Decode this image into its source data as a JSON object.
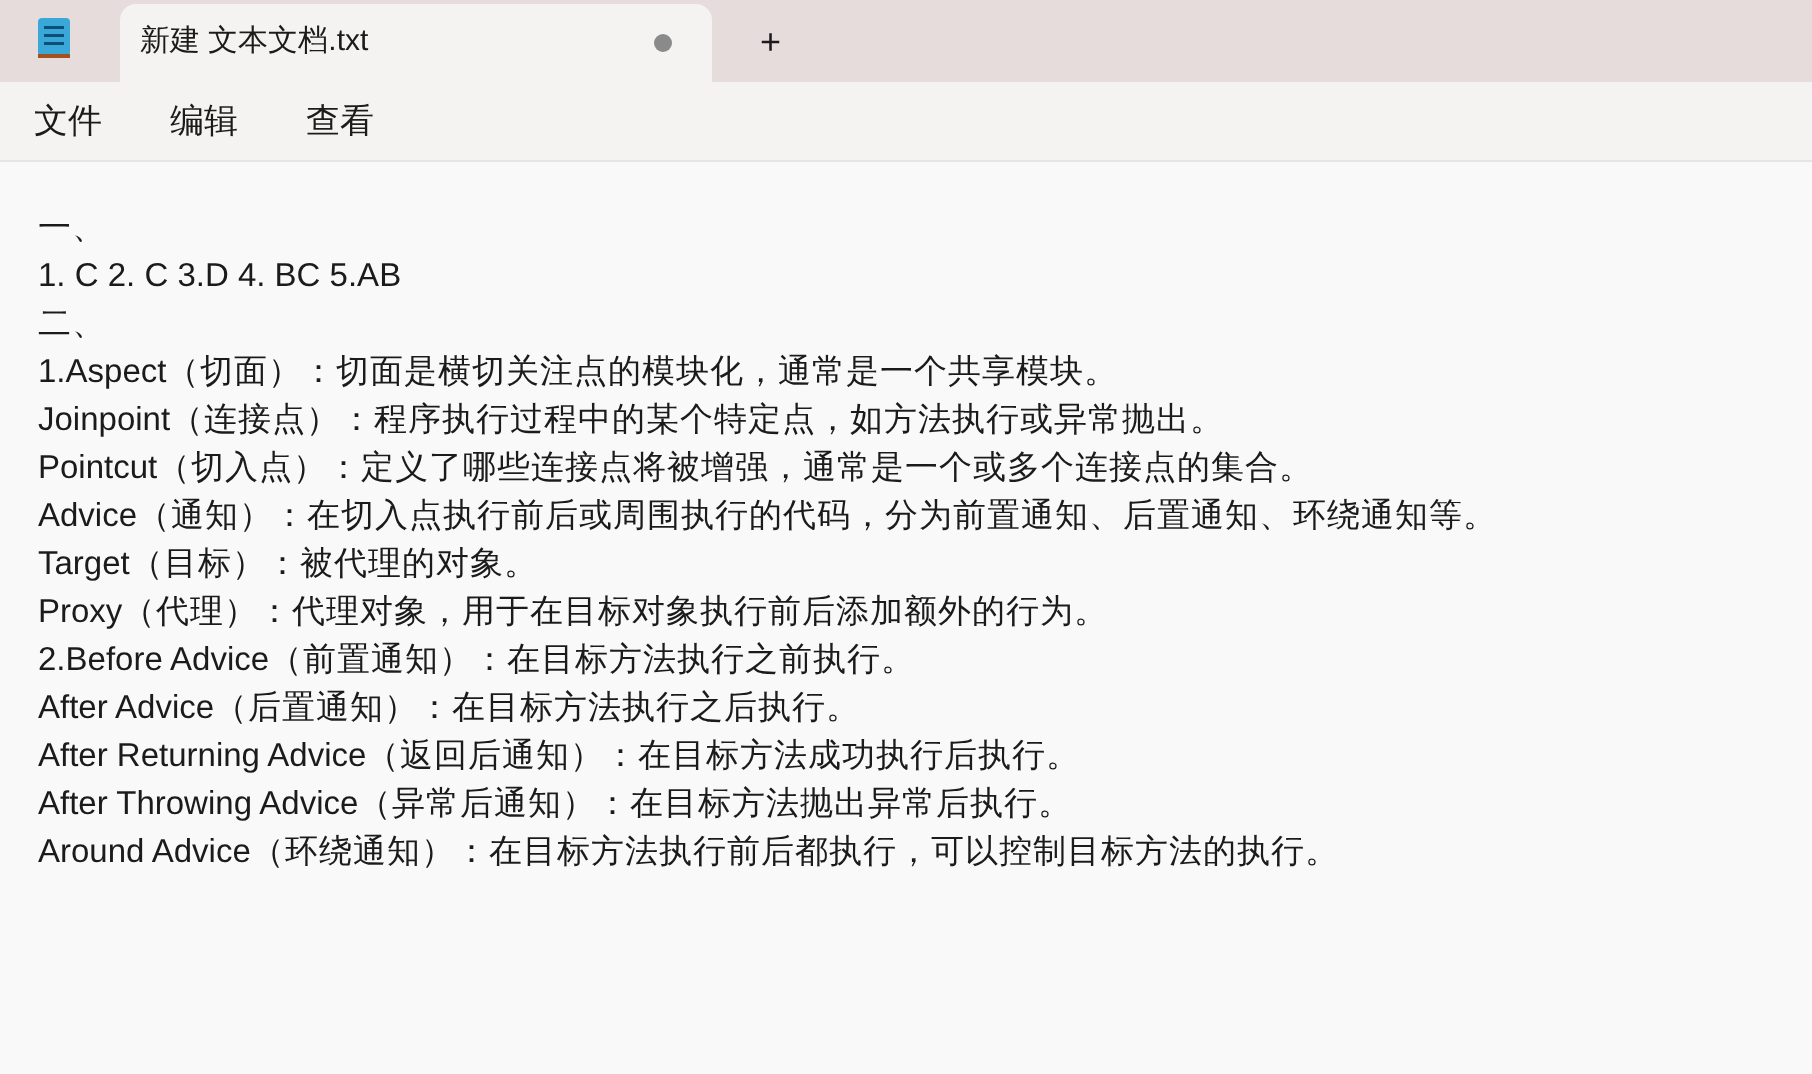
{
  "tabs": [
    {
      "title": "新建 文本文档.txt",
      "selected": true,
      "unsaved": true
    }
  ],
  "new_tab_button": "+",
  "menu": [
    "文件",
    "编辑",
    "查看"
  ],
  "lines": [
    "一、",
    "1. C 2. C 3.D  4. BC 5.AB",
    "二、",
    "1.Aspect（切面）：切面是横切关注点的模块化，通常是一个共享模块。",
    "Joinpoint（连接点）：程序执行过程中的某个特定点，如方法执行或异常抛出。",
    "Pointcut（切入点）：定义了哪些连接点将被增强，通常是一个或多个连接点的集合。",
    "Advice（通知）：在切入点执行前后或周围执行的代码，分为前置通知、后置通知、环绕通知等。",
    "Target（目标）：被代理的对象。",
    "Proxy（代理）：代理对象，用于在目标对象执行前后添加额外的行为。",
    "2.Before Advice（前置通知）：在目标方法执行之前执行。",
    "After Advice（后置通知）：在目标方法执行之后执行。",
    "After Returning Advice（返回后通知）：在目标方法成功执行后执行。",
    "After Throwing Advice（异常后通知）：在目标方法抛出异常后执行。",
    "Around Advice（环绕通知）：在目标方法执行前后都执行，可以控制目标方法的执行。"
  ]
}
